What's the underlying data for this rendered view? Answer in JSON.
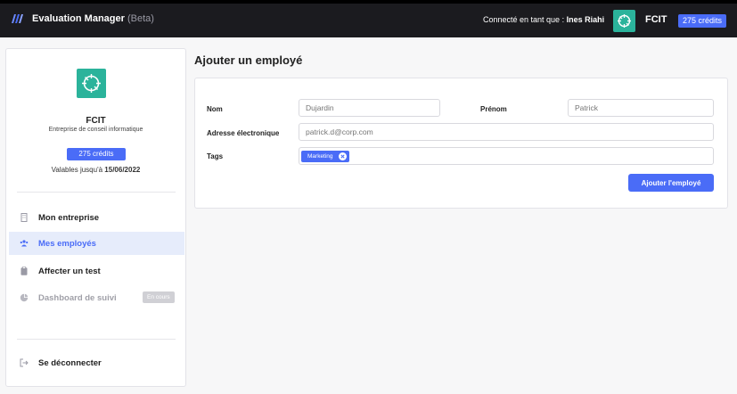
{
  "header": {
    "app_title": "Evaluation Manager",
    "app_beta": "(Beta)",
    "user_prefix": "Connecté en tant que :",
    "user_name": "Ines Riahi",
    "company": "FCIT",
    "credits": "275 crédits"
  },
  "sidebar": {
    "company_name": "FCIT",
    "company_desc": "Entreprise de conseil informatique",
    "credits": "275 crédits",
    "valid_prefix": "Valables jusqu'à",
    "valid_date": "15/06/2022",
    "items": [
      {
        "label": "Mon entreprise",
        "icon": "building-icon",
        "active": false
      },
      {
        "label": "Mes employés",
        "icon": "users-icon",
        "active": true
      },
      {
        "label": "Affecter un test",
        "icon": "clipboard-icon",
        "active": false
      },
      {
        "label": "Dashboard de suivi",
        "icon": "chart-pie-icon",
        "active": false,
        "badge": "En cours"
      }
    ],
    "logout": "Se déconnecter"
  },
  "main": {
    "title": "Ajouter un employé",
    "form": {
      "nom_label": "Nom",
      "nom_placeholder": "Dujardin",
      "prenom_label": "Prénom",
      "prenom_placeholder": "Patrick",
      "email_label": "Adresse électronique",
      "email_placeholder": "patrick.d@corp.com",
      "tags_label": "Tags",
      "tags": [
        "Marketing"
      ],
      "submit": "Ajouter l'employé"
    }
  },
  "colors": {
    "accent": "#4a6cf7",
    "brand_green": "#2bb39b",
    "topbar": "#1b1b1f"
  }
}
